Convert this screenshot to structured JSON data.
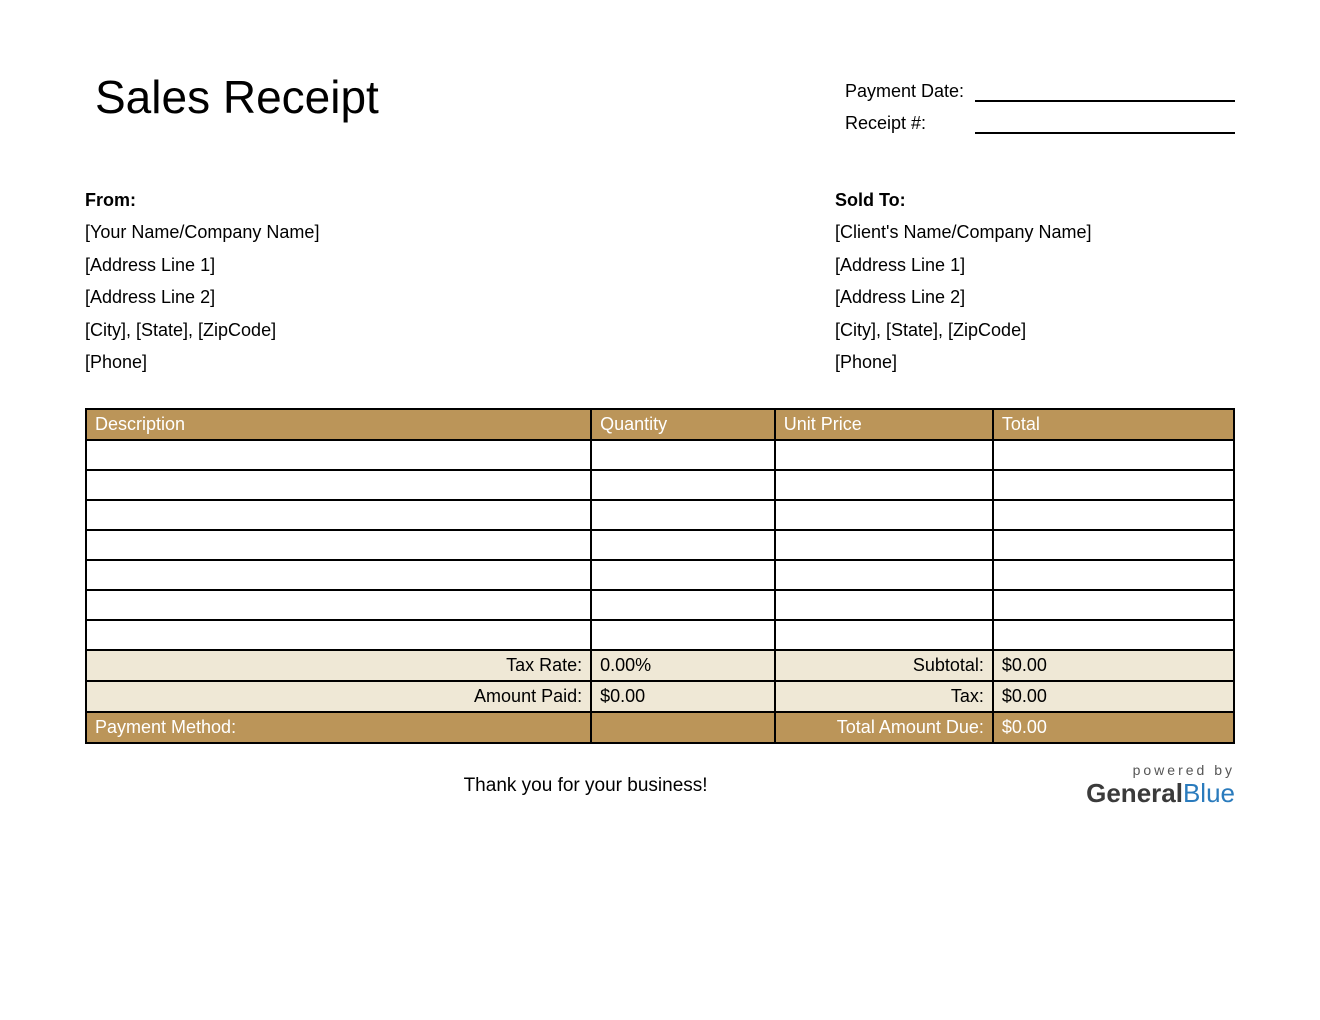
{
  "title": "Sales Receipt",
  "meta": {
    "payment_date_label": "Payment Date:",
    "payment_date_value": "",
    "receipt_num_label": "Receipt #:",
    "receipt_num_value": ""
  },
  "from": {
    "heading": "From:",
    "name": "[Your Name/Company Name]",
    "addr1": "[Address Line 1]",
    "addr2": "[Address Line 2]",
    "city_state_zip": "[City], [State], [ZipCode]",
    "phone": "[Phone]"
  },
  "sold_to": {
    "heading": "Sold To:",
    "name": "[Client's Name/Company Name]",
    "addr1": "[Address Line 1]",
    "addr2": "[Address Line 2]",
    "city_state_zip": "[City], [State], [ZipCode]",
    "phone": "[Phone]"
  },
  "columns": {
    "description": "Description",
    "quantity": "Quantity",
    "unit_price": "Unit Price",
    "total": "Total"
  },
  "summary": {
    "tax_rate_label": "Tax Rate:",
    "tax_rate_value": "0.00%",
    "subtotal_label": "Subtotal:",
    "subtotal_value": "$0.00",
    "amount_paid_label": "Amount Paid:",
    "amount_paid_value": "$0.00",
    "tax_label": "Tax:",
    "tax_value": "$0.00",
    "payment_method_label": "Payment Method:",
    "payment_method_value": "",
    "total_due_label": "Total Amount Due:",
    "total_due_value": "$0.00"
  },
  "thanks": "Thank you for your business!",
  "logo": {
    "powered": "powered by",
    "general": "General",
    "blue": "Blue"
  }
}
